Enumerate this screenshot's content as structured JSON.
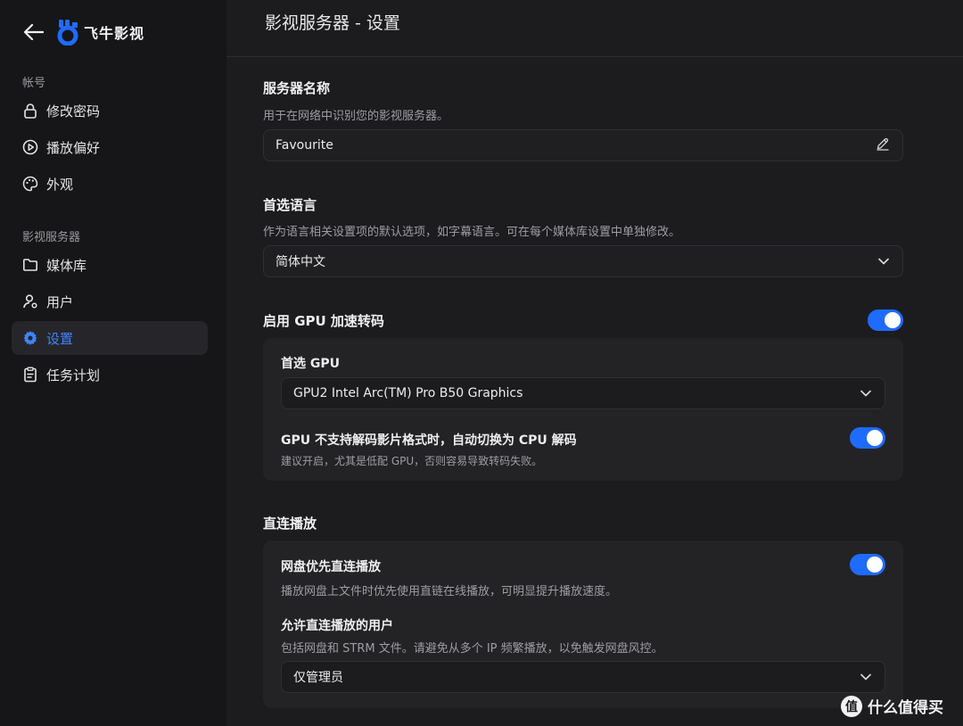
{
  "app": {
    "name": "飞牛影视"
  },
  "sidebar": {
    "groups": [
      {
        "label": "帐号"
      },
      {
        "label": "影视服务器"
      }
    ],
    "items": [
      {
        "label": "修改密码",
        "icon": "lock-icon"
      },
      {
        "label": "播放偏好",
        "icon": "play-circle-icon"
      },
      {
        "label": "外观",
        "icon": "palette-icon"
      },
      {
        "label": "媒体库",
        "icon": "folder-icon"
      },
      {
        "label": "用户",
        "icon": "user-gear-icon"
      },
      {
        "label": "设置",
        "icon": "gear-icon",
        "active": true
      },
      {
        "label": "任务计划",
        "icon": "clipboard-icon"
      }
    ]
  },
  "header": {
    "title": "影视服务器 - 设置"
  },
  "server_name": {
    "title": "服务器名称",
    "description": "用于在网络中识别您的影视服务器。",
    "value": "Favourite"
  },
  "language": {
    "title": "首选语言",
    "description": "作为语言相关设置项的默认选项，如字幕语言。可在每个媒体库设置中单独修改。",
    "value": "简体中文"
  },
  "gpu": {
    "title": "启用 GPU 加速转码",
    "enabled": true,
    "preferred_label": "首选 GPU",
    "preferred_value": "GPU2 Intel Arc(TM) Pro B50 Graphics",
    "fallback_title": "GPU 不支持解码影片格式时，自动切换为 CPU 解码",
    "fallback_desc": "建议开启，尤其是低配 GPU，否则容易导致转码失败。",
    "fallback_enabled": true
  },
  "direct_play": {
    "title": "直连播放",
    "netdisk_title": "网盘优先直连播放",
    "netdisk_desc": "播放网盘上文件时优先使用直链在线播放，可明显提升播放速度。",
    "netdisk_enabled": true,
    "users_title": "允许直连播放的用户",
    "users_desc": "包括网盘和 STRM 文件。请避免从多个 IP 频繁播放，以免触发网盘风控。",
    "users_value": "仅管理员"
  },
  "watermark": {
    "badge": "值",
    "text": "什么值得买"
  },
  "colors": {
    "accent": "#1f6bff",
    "active_nav": "#3d84ff",
    "background": "#1c1c1f",
    "sidebar": "#161618",
    "card": "#232326"
  }
}
